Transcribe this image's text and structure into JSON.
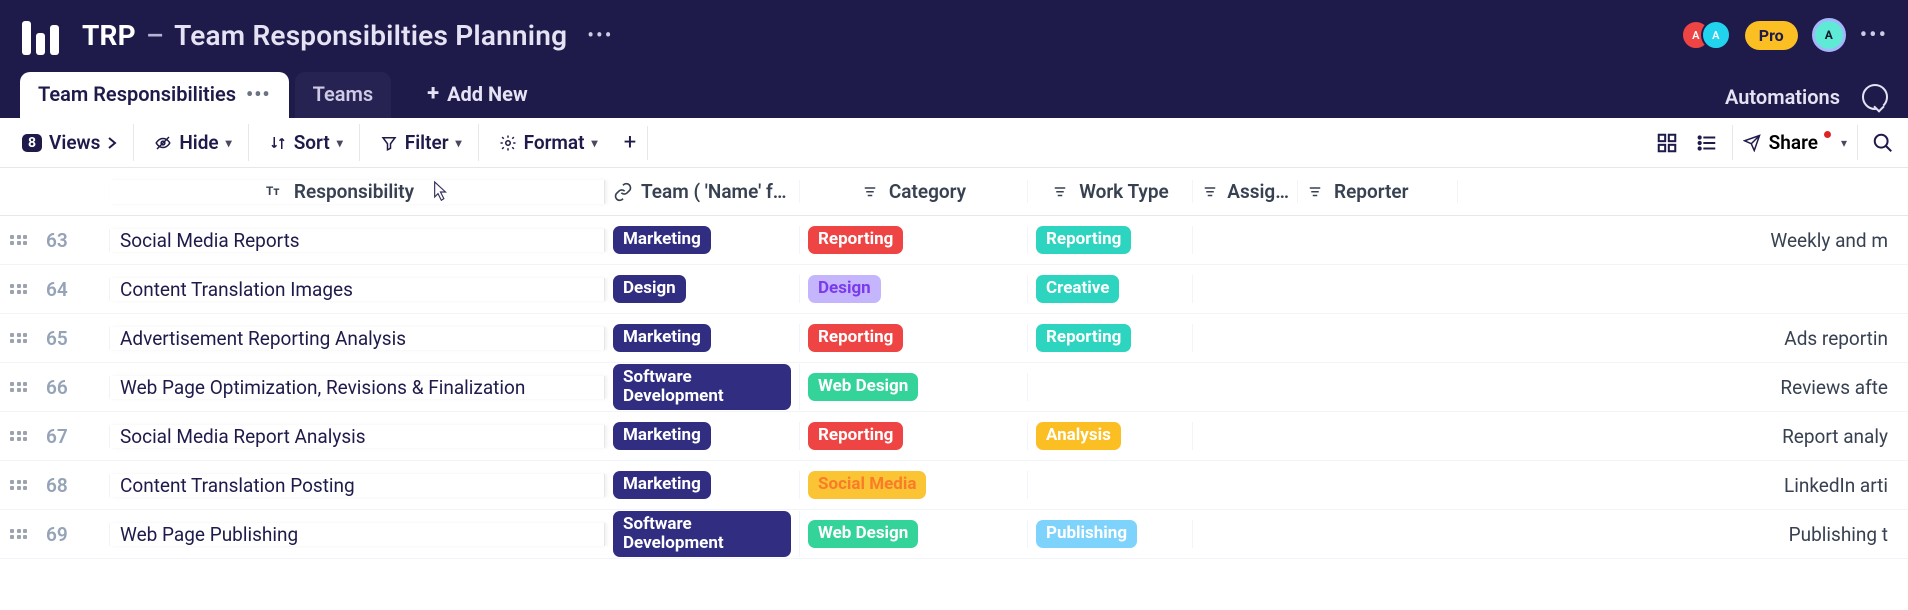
{
  "header": {
    "abbr": "TRP",
    "sep": "–",
    "title": "Team Responsibilties Planning",
    "pro_label": "Pro"
  },
  "tabs": {
    "active": "Team Responsibilities",
    "inactive": "Teams",
    "add": "Add New",
    "automations": "Automations"
  },
  "toolbar": {
    "views_count": "8",
    "views": "Views",
    "hide": "Hide",
    "sort": "Sort",
    "filter": "Filter",
    "format": "Format",
    "share": "Share"
  },
  "columns": {
    "responsibility": "Responsibility",
    "team": "Team ( 'Name' f…",
    "category": "Category",
    "worktype": "Work Type",
    "assignee": "Assig…",
    "reporter": "Reporter"
  },
  "rows": [
    {
      "n": "63",
      "resp": "Social Media Reports",
      "team": "Marketing",
      "cat": "Reporting",
      "cat_cls": "t-report",
      "wt": "Reporting",
      "wt_cls": "t-wt-report",
      "last": "Weekly and m"
    },
    {
      "n": "64",
      "resp": "Content Translation Images",
      "team": "Design",
      "cat": "Design",
      "cat_cls": "t-design",
      "wt": "Creative",
      "wt_cls": "t-creative",
      "last": ""
    },
    {
      "n": "65",
      "resp": "Advertisement Reporting Analysis",
      "team": "Marketing",
      "cat": "Reporting",
      "cat_cls": "t-report",
      "wt": "Reporting",
      "wt_cls": "t-wt-report",
      "last": "Ads reportin"
    },
    {
      "n": "66",
      "resp": "Web Page Optimization, Revisions & Finalization",
      "team": "Software Development",
      "cat": "Web Design",
      "cat_cls": "t-web",
      "wt": "",
      "wt_cls": "",
      "last": "Reviews afte"
    },
    {
      "n": "67",
      "resp": "Social Media Report Analysis",
      "team": "Marketing",
      "cat": "Reporting",
      "cat_cls": "t-report",
      "wt": "Analysis",
      "wt_cls": "t-analysis",
      "last": "Report analy"
    },
    {
      "n": "68",
      "resp": "Content Translation Posting",
      "team": "Marketing",
      "cat": "Social Media",
      "cat_cls": "t-social",
      "wt": "",
      "wt_cls": "",
      "last": "LinkedIn arti"
    },
    {
      "n": "69",
      "resp": "Web Page Publishing",
      "team": "Software Development",
      "cat": "Web Design",
      "cat_cls": "t-web",
      "wt": "Publishing",
      "wt_cls": "t-publish",
      "last": "Publishing t"
    }
  ]
}
